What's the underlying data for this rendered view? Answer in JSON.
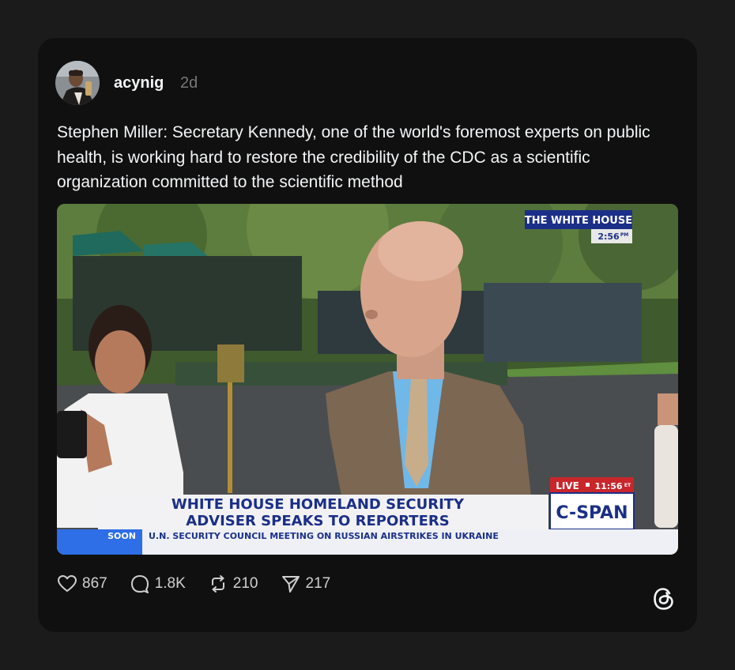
{
  "post": {
    "username": "acynig",
    "timestamp": "2d",
    "text": "Stephen Miller: Secretary Kennedy, one of the world's foremost experts on public health, is working hard to restore the credibility of the CDC as a scientific organization committed to the scientific method"
  },
  "video": {
    "location_bug": "THE WHITE HOUSE",
    "location_time": "2:56",
    "location_time_suffix": "PM",
    "live_label": "LIVE",
    "live_time": "11:56",
    "live_suffix": "ET",
    "network": "C-SPAN",
    "headline_line1": "WHITE HOUSE HOMELAND SECURITY",
    "headline_line2": "ADVISER SPEAKS TO REPORTERS",
    "ticker_label": "SOON",
    "ticker_text": "U.N. SECURITY COUNCIL MEETING ON RUSSIAN AIRSTRIKES IN UKRAINE"
  },
  "actions": {
    "likes": "867",
    "replies": "1.8K",
    "reposts": "210",
    "shares": "217"
  },
  "icons": [
    "heart-icon",
    "comment-icon",
    "repost-icon",
    "share-icon",
    "threads-logo-icon"
  ]
}
